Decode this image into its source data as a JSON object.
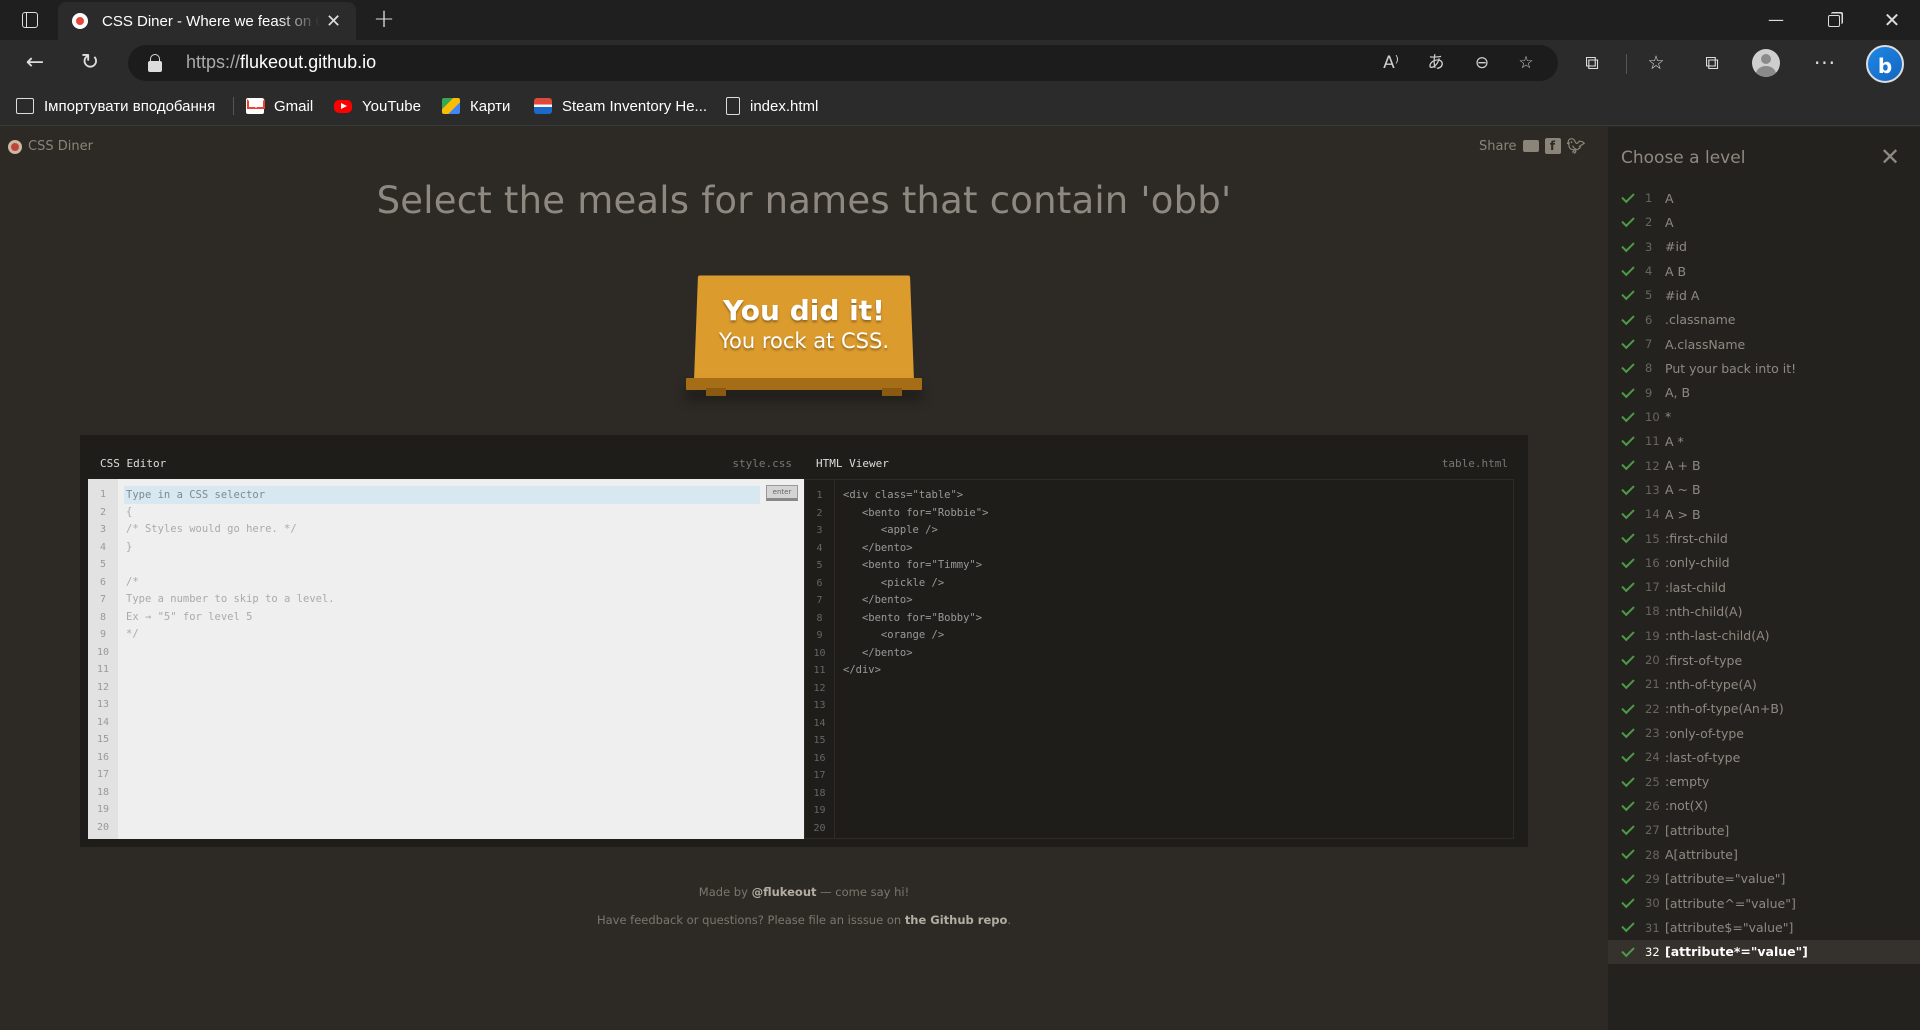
{
  "browser": {
    "tab_title": "CSS Diner - Where we feast on CSS Selectors",
    "url_scheme": "https://",
    "url_host": "flukeout.github.io",
    "bookmarks": [
      {
        "label": "Імпортувати вподобання",
        "icon": "import-icon"
      },
      {
        "label": "Gmail",
        "icon": "gmail-icon"
      },
      {
        "label": "YouTube",
        "icon": "youtube-icon"
      },
      {
        "label": "Карти",
        "icon": "maps-icon"
      },
      {
        "label": "Steam Inventory He...",
        "icon": "steam-icon"
      },
      {
        "label": "index.html",
        "icon": "file-icon"
      }
    ]
  },
  "page": {
    "logo_text": "CSS Diner",
    "share_label": "Share",
    "heading": "Select the meals for names that contain 'obb'",
    "win_line1": "You did it!",
    "win_line2": "You rock at CSS.",
    "css_editor": {
      "title": "CSS Editor",
      "file": "style.css",
      "input_placeholder": "Type in a CSS selector",
      "enter_label": "enter",
      "lines": [
        "",
        "{",
        "/* Styles would go here. */",
        "}",
        "",
        "/*",
        "Type a number to skip to a level.",
        "Ex → \"5\" for level 5",
        "*/"
      ]
    },
    "html_viewer": {
      "title": "HTML Viewer",
      "file": "table.html",
      "lines": [
        "<div class=\"table\">",
        "   <bento for=\"Robbie\">",
        "      <apple />",
        "   </bento>",
        "   <bento for=\"Timmy\">",
        "      <pickle />",
        "   </bento>",
        "   <bento for=\"Bobby\">",
        "      <orange />",
        "   </bento>",
        "</div>"
      ]
    },
    "line_count": 20,
    "footer": {
      "made_by_prefix": "Made by ",
      "made_by_link": "@flukeout",
      "made_by_suffix": " — come say hi!",
      "feedback_prefix": "Have feedback or questions? Please file an isssue on ",
      "feedback_link": "the Github repo",
      "feedback_suffix": "."
    }
  },
  "sidebar": {
    "title": "Choose a level",
    "current_level": 32,
    "levels": [
      {
        "num": "1",
        "name": "A"
      },
      {
        "num": "2",
        "name": "A"
      },
      {
        "num": "3",
        "name": "#id"
      },
      {
        "num": "4",
        "name": "A B"
      },
      {
        "num": "5",
        "name": "#id  A"
      },
      {
        "num": "6",
        "name": ".classname"
      },
      {
        "num": "7",
        "name": "A.className"
      },
      {
        "num": "8",
        "name": "Put your back into it!"
      },
      {
        "num": "9",
        "name": "A, B"
      },
      {
        "num": "10",
        "name": "*"
      },
      {
        "num": "11",
        "name": "A  *"
      },
      {
        "num": "12",
        "name": "A + B"
      },
      {
        "num": "13",
        "name": "A ~ B"
      },
      {
        "num": "14",
        "name": "A > B"
      },
      {
        "num": "15",
        "name": ":first-child"
      },
      {
        "num": "16",
        "name": ":only-child"
      },
      {
        "num": "17",
        "name": ":last-child"
      },
      {
        "num": "18",
        "name": ":nth-child(A)"
      },
      {
        "num": "19",
        "name": ":nth-last-child(A)"
      },
      {
        "num": "20",
        "name": ":first-of-type"
      },
      {
        "num": "21",
        "name": ":nth-of-type(A)"
      },
      {
        "num": "22",
        "name": ":nth-of-type(An+B)"
      },
      {
        "num": "23",
        "name": ":only-of-type"
      },
      {
        "num": "24",
        "name": ":last-of-type"
      },
      {
        "num": "25",
        "name": ":empty"
      },
      {
        "num": "26",
        "name": ":not(X)"
      },
      {
        "num": "27",
        "name": "[attribute]"
      },
      {
        "num": "28",
        "name": "A[attribute]"
      },
      {
        "num": "29",
        "name": "[attribute=\"value\"]"
      },
      {
        "num": "30",
        "name": "[attribute^=\"value\"]"
      },
      {
        "num": "31",
        "name": "[attribute$=\"value\"]"
      },
      {
        "num": "32",
        "name": "[attribute*=\"value\"]"
      }
    ]
  },
  "colors": {
    "accent_table": "#dc9b2d",
    "check_green": "#4c9a47",
    "page_bg": "#2d2a25"
  }
}
